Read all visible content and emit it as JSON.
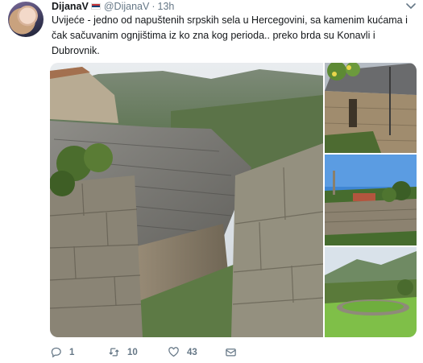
{
  "user": {
    "display_name": "DijanaV",
    "handle": "@DijanaV",
    "separator": "·",
    "time": "13h"
  },
  "tweet": {
    "text": "Uvijeće - jedno od napuštenih srpskih sela u Hercegovini, sa kamenim kućama i čak sačuvanim ognjištima iz ko zna kog perioda.. preko brda su Konavli i Dubrovnik."
  },
  "actions": {
    "replies": "1",
    "retweets": "10",
    "likes": "43"
  },
  "icons": {
    "reply": "reply-icon",
    "retweet": "retweet-icon",
    "like": "heart-icon",
    "dm": "envelope-icon",
    "caret": "chevron-down-icon"
  },
  "colors": {
    "text": "#14171a",
    "secondary": "#657786"
  }
}
